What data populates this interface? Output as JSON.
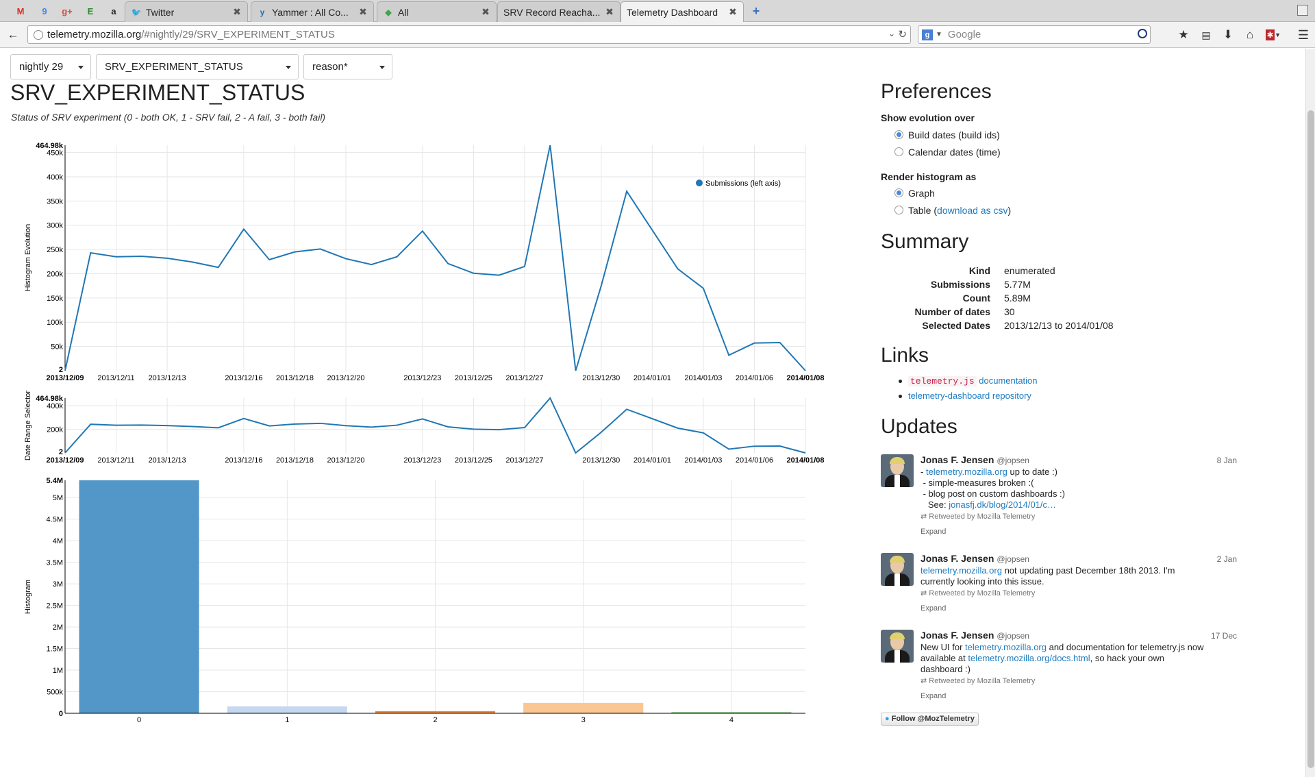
{
  "browser": {
    "pinned_tabs": [
      {
        "icon": "gmail-icon",
        "glyph": "M",
        "color": "#d93025"
      },
      {
        "icon": "calendar-icon",
        "glyph": "9",
        "color": "#4285f4"
      },
      {
        "icon": "google-plus-icon",
        "glyph": "g+",
        "color": "#dd4b39"
      },
      {
        "icon": "evernote-icon",
        "glyph": "E",
        "color": "#2e8b2e"
      },
      {
        "icon": "amazon-icon",
        "glyph": "a",
        "color": "#222222"
      }
    ],
    "tabs": [
      {
        "label": "Twitter",
        "icon": "twitter-icon",
        "glyph": "🐦"
      },
      {
        "label": "Yammer : All Co...",
        "icon": "yammer-icon",
        "glyph": "y"
      },
      {
        "label": "All",
        "icon": "feedly-icon",
        "glyph": "◆"
      },
      {
        "label": "SRV Record Reacha...",
        "icon": "",
        "glyph": ""
      },
      {
        "label": "Telemetry Dashboard",
        "icon": "",
        "glyph": ""
      }
    ],
    "url": {
      "host": "telemetry.mozilla.org",
      "path": "/#nightly/29/SRV_EXPERIMENT_STATUS"
    },
    "search_placeholder": "Google"
  },
  "filters": {
    "channel": "nightly 29",
    "measure": "SRV_EXPERIMENT_STATUS",
    "filter": "reason*"
  },
  "main": {
    "title": "SRV_EXPERIMENT_STATUS",
    "description": "Status of SRV experiment (0 - both OK, 1 - SRV fail, 2 - A fail, 3 - both fail)"
  },
  "chart_data": [
    {
      "type": "line",
      "ylabel": "Histogram Evolution",
      "legend": "Submissions (left axis)",
      "legend_position": "top-right",
      "color": "#1f77b4",
      "x": [
        "2013/12/09",
        "2013/12/10",
        "2013/12/11",
        "2013/12/12",
        "2013/12/13",
        "2013/12/14",
        "2013/12/15",
        "2013/12/16",
        "2013/12/17",
        "2013/12/18",
        "2013/12/19",
        "2013/12/20",
        "2013/12/21",
        "2013/12/22",
        "2013/12/23",
        "2013/12/24",
        "2013/12/25",
        "2013/12/26",
        "2013/12/27",
        "2013/12/28",
        "2013/12/29",
        "2013/12/30",
        "2013/12/31",
        "2014/01/01",
        "2014/01/02",
        "2014/01/03",
        "2014/01/04",
        "2014/01/06",
        "2014/01/07",
        "2014/01/08"
      ],
      "values": [
        2,
        243000,
        235000,
        236000,
        232000,
        224000,
        213000,
        292000,
        229000,
        245000,
        251000,
        231000,
        219000,
        235000,
        288000,
        221000,
        201000,
        197000,
        215000,
        464980,
        2,
        175000,
        370000,
        290000,
        210000,
        170000,
        32000,
        57000,
        58000,
        2
      ],
      "x_ticks": [
        "2013/12/09",
        "2013/12/11",
        "2013/12/13",
        "2013/12/16",
        "2013/12/18",
        "2013/12/20",
        "2013/12/23",
        "2013/12/25",
        "2013/12/27",
        "2013/12/30",
        "2014/01/01",
        "2014/01/03",
        "2014/01/06",
        "2014/01/08"
      ],
      "y_ticks": [
        "50k",
        "100k",
        "150k",
        "200k",
        "250k",
        "300k",
        "350k",
        "400k",
        "450k"
      ],
      "y_min_label": "2",
      "y_max_label": "464.98k",
      "ylim": [
        2,
        464980
      ],
      "grid": true
    },
    {
      "type": "line",
      "ylabel": "Date Range Selector",
      "color": "#1f77b4",
      "x_ticks": [
        "2013/12/09",
        "2013/12/11",
        "2013/12/13",
        "2013/12/16",
        "2013/12/18",
        "2013/12/20",
        "2013/12/23",
        "2013/12/25",
        "2013/12/27",
        "2013/12/30",
        "2014/01/01",
        "2014/01/03",
        "2014/01/06",
        "2014/01/08"
      ],
      "y_ticks": [
        "200k",
        "400k"
      ],
      "y_min_label": "2",
      "y_max_label": "464.98k",
      "ylim": [
        2,
        464980
      ],
      "grid": true
    },
    {
      "type": "bar",
      "ylabel": "Histogram",
      "categories": [
        "0",
        "1",
        "2",
        "3",
        "4"
      ],
      "values": [
        5400000,
        160000,
        50000,
        240000,
        10000
      ],
      "colors": [
        "#5397c8",
        "#c6d8f0",
        "#f0883a",
        "#fcc692",
        "#5aa85a"
      ],
      "y_ticks": [
        "500k",
        "1M",
        "1.5M",
        "2M",
        "2.5M",
        "3M",
        "3.5M",
        "4M",
        "4.5M",
        "5M"
      ],
      "y_min_label": "0",
      "y_max_label": "5.4M",
      "ylim": [
        0,
        5400000
      ],
      "grid": true
    }
  ],
  "preferences": {
    "title": "Preferences",
    "evolution_label": "Show evolution over",
    "evolution_options": [
      "Build dates (build ids)",
      "Calendar dates (time)"
    ],
    "render_label": "Render histogram as",
    "render_options": [
      "Graph",
      "Table ("
    ],
    "csv_link": "download as csv",
    "csv_close": ")"
  },
  "summary": {
    "title": "Summary",
    "rows": [
      {
        "key": "Kind",
        "value": "enumerated"
      },
      {
        "key": "Submissions",
        "value": "5.77M"
      },
      {
        "key": "Count",
        "value": "5.89M"
      },
      {
        "key": "Number of dates",
        "value": "30"
      },
      {
        "key": "Selected Dates",
        "value": "2013/12/13 to 2014/01/08"
      }
    ]
  },
  "links": {
    "title": "Links",
    "items": [
      {
        "code": "telemetry.js",
        "text": " documentation"
      },
      {
        "code": "",
        "text": "telemetry-dashboard repository"
      }
    ]
  },
  "updates": {
    "title": "Updates",
    "tweets": [
      {
        "name": "Jonas F. Jensen",
        "handle": "@jopsen",
        "date": "8 Jan",
        "lines": [
          {
            "pre": "- ",
            "link": "telemetry.mozilla.org",
            "post": " up to date :)"
          },
          {
            "pre": " - simple-measures broken :(",
            "link": "",
            "post": ""
          },
          {
            "pre": " - blog post on custom dashboards :)",
            "link": "",
            "post": ""
          },
          {
            "pre": "   See: ",
            "link": "jonasfj.dk/blog/2014/01/c…",
            "post": ""
          }
        ],
        "retweet": "Retweeted by Mozilla Telemetry",
        "expand": "Expand"
      },
      {
        "name": "Jonas F. Jensen",
        "handle": "@jopsen",
        "date": "2 Jan",
        "lines": [
          {
            "pre": "",
            "link": "telemetry.mozilla.org",
            "post": " not updating past December 18th 2013. I'm"
          },
          {
            "pre": "currently looking into this issue.",
            "link": "",
            "post": ""
          }
        ],
        "retweet": "Retweeted by Mozilla Telemetry",
        "expand": "Expand"
      },
      {
        "name": "Jonas F. Jensen",
        "handle": "@jopsen",
        "date": "17 Dec",
        "lines": [
          {
            "pre": "New UI for ",
            "link": "telemetry.mozilla.org",
            "post": " and documentation for telemetry.js now"
          },
          {
            "pre": "available at ",
            "link": "telemetry.mozilla.org/docs.html",
            "post": ", so hack your own"
          },
          {
            "pre": "dashboard :)",
            "link": "",
            "post": ""
          }
        ],
        "retweet": "Retweeted by Mozilla Telemetry",
        "expand": "Expand"
      }
    ],
    "follow_button": "Follow @MozTelemetry"
  }
}
